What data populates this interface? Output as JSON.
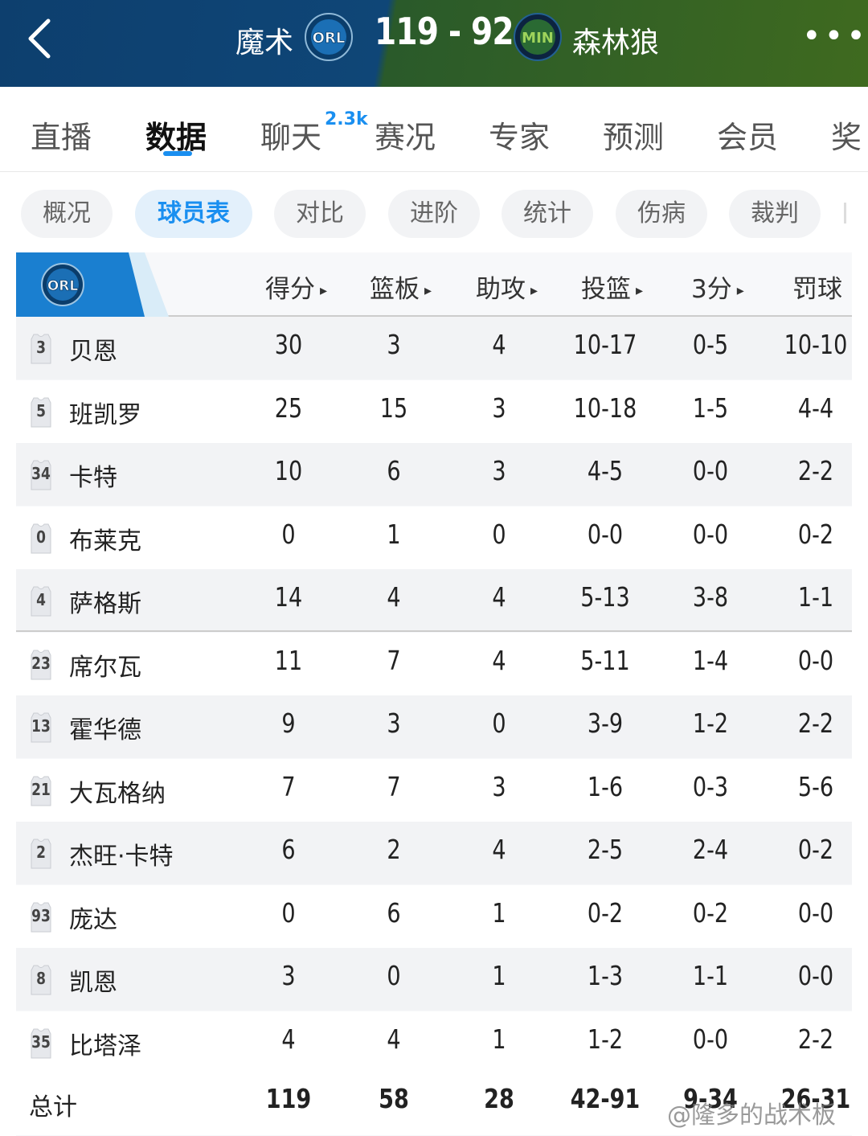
{
  "header": {
    "home_team": "魔术",
    "home_abbr": "ORL",
    "score": "119 - 92",
    "away_abbr": "MIN",
    "away_team": "森林狼"
  },
  "tabs": [
    {
      "label": "直播"
    },
    {
      "label": "数据"
    },
    {
      "label": "聊天"
    },
    {
      "label": "赛况"
    },
    {
      "label": "专家"
    },
    {
      "label": "预测"
    },
    {
      "label": "会员"
    },
    {
      "label": "奖"
    }
  ],
  "chat_badge": "2.3k",
  "subtabs": [
    {
      "label": "概况"
    },
    {
      "label": "球员表"
    },
    {
      "label": "对比"
    },
    {
      "label": "进阶"
    },
    {
      "label": "统计"
    },
    {
      "label": "伤病"
    },
    {
      "label": "裁判"
    }
  ],
  "table": {
    "team_abbr": "ORL",
    "columns": [
      "得分",
      "篮板",
      "助攻",
      "投篮",
      "3分",
      "罚球"
    ],
    "players": [
      {
        "num": "3",
        "name": "贝恩",
        "stats": [
          "30",
          "3",
          "4",
          "10-17",
          "0-5",
          "10-10"
        ]
      },
      {
        "num": "5",
        "name": "班凯罗",
        "stats": [
          "25",
          "15",
          "3",
          "10-18",
          "1-5",
          "4-4"
        ]
      },
      {
        "num": "34",
        "name": "卡特",
        "stats": [
          "10",
          "6",
          "3",
          "4-5",
          "0-0",
          "2-2"
        ]
      },
      {
        "num": "0",
        "name": "布莱克",
        "stats": [
          "0",
          "1",
          "0",
          "0-0",
          "0-0",
          "0-2"
        ]
      },
      {
        "num": "4",
        "name": "萨格斯",
        "stats": [
          "14",
          "4",
          "4",
          "5-13",
          "3-8",
          "1-1"
        ]
      },
      {
        "num": "23",
        "name": "席尔瓦",
        "stats": [
          "11",
          "7",
          "4",
          "5-11",
          "1-4",
          "0-0"
        ]
      },
      {
        "num": "13",
        "name": "霍华德",
        "stats": [
          "9",
          "3",
          "0",
          "3-9",
          "1-2",
          "2-2"
        ]
      },
      {
        "num": "21",
        "name": "大瓦格纳",
        "stats": [
          "7",
          "7",
          "3",
          "1-6",
          "0-3",
          "5-6"
        ]
      },
      {
        "num": "2",
        "name": "杰旺·卡特",
        "stats": [
          "6",
          "2",
          "4",
          "2-5",
          "2-4",
          "0-2"
        ]
      },
      {
        "num": "93",
        "name": "庞达",
        "stats": [
          "0",
          "6",
          "1",
          "0-2",
          "0-2",
          "0-0"
        ]
      },
      {
        "num": "8",
        "name": "凯恩",
        "stats": [
          "3",
          "0",
          "1",
          "1-3",
          "1-1",
          "0-0"
        ]
      },
      {
        "num": "35",
        "name": "比塔泽",
        "stats": [
          "4",
          "4",
          "1",
          "1-2",
          "0-0",
          "2-2"
        ]
      }
    ],
    "total": {
      "label": "总计",
      "stats": [
        "119",
        "58",
        "28",
        "42-91",
        "9-34",
        "26-31"
      ]
    }
  },
  "watermark": "@隆多的战术板",
  "colors": {
    "accent": "#1a8ff0",
    "home": "#0d3f6e",
    "away": "#3f6a1f"
  }
}
